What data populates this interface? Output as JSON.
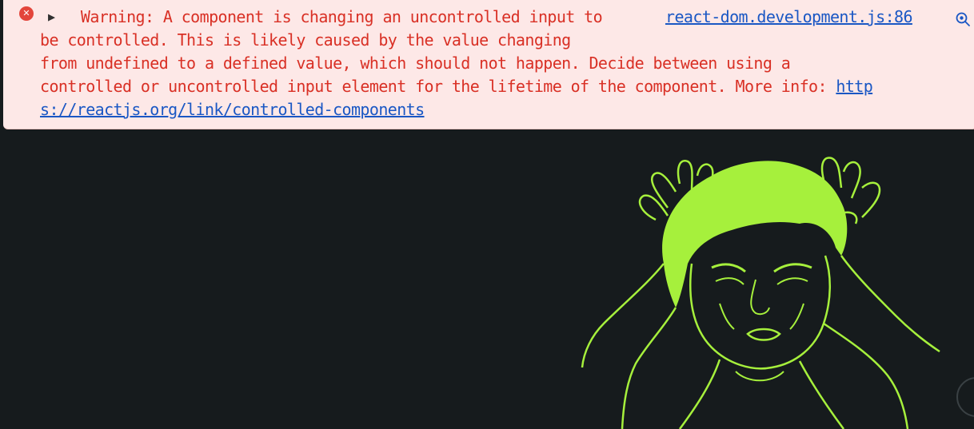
{
  "console": {
    "toggle_glyph": "▶",
    "message_lines": [
      "Warning: A component is changing an uncontrolled input to",
      "be controlled. This is likely caused by the value changing",
      "from undefined to a defined value, which should not happen. Decide between using a",
      "controlled or uncontrolled input element for the lifetime of the component. More info: "
    ],
    "link_part1": "http",
    "link_part2": "s://reactjs.org/link/controlled-components",
    "source_link": "react-dom.development.js:86",
    "error_icon_glyph": "✕",
    "icons": {
      "error": "error-circle-icon",
      "inspect": "magnifier-icon"
    }
  },
  "colors": {
    "warning_bg": "#fde8e7",
    "warning_text": "#d93025",
    "link": "#1a57c4",
    "backdrop": "#161b1d",
    "meme_line": "#a6f03c"
  },
  "illustration": {
    "name": "confused-man-line-art"
  }
}
